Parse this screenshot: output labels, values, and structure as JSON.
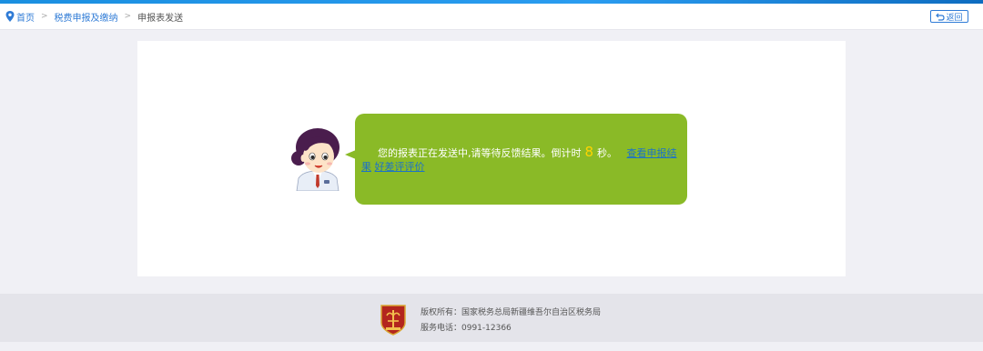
{
  "breadcrumb": {
    "home": "首页",
    "level1": "税费申报及缴纳",
    "current": "申报表发送",
    "separator": ">"
  },
  "header": {
    "back_label": "返回"
  },
  "message": {
    "text_before": "您的报表正在发送中,请等待反馈结果。倒计时",
    "countdown": "8",
    "text_after": "秒。",
    "link_view_result": "查看申报结果",
    "link_rate": "好差评评价"
  },
  "footer": {
    "copyright": "版权所有：国家税务总局新疆维吾尔自治区税务局",
    "phone": "服务电话：0991-12366"
  },
  "colors": {
    "accent": "#2f7bd6",
    "bubble": "#8aba27",
    "countdown": "#ffd400",
    "link": "#1c72c8"
  },
  "icons": {
    "breadcrumb_home": "map-pin-icon",
    "back": "undo-icon",
    "footer_logo": "tax-emblem-icon"
  }
}
